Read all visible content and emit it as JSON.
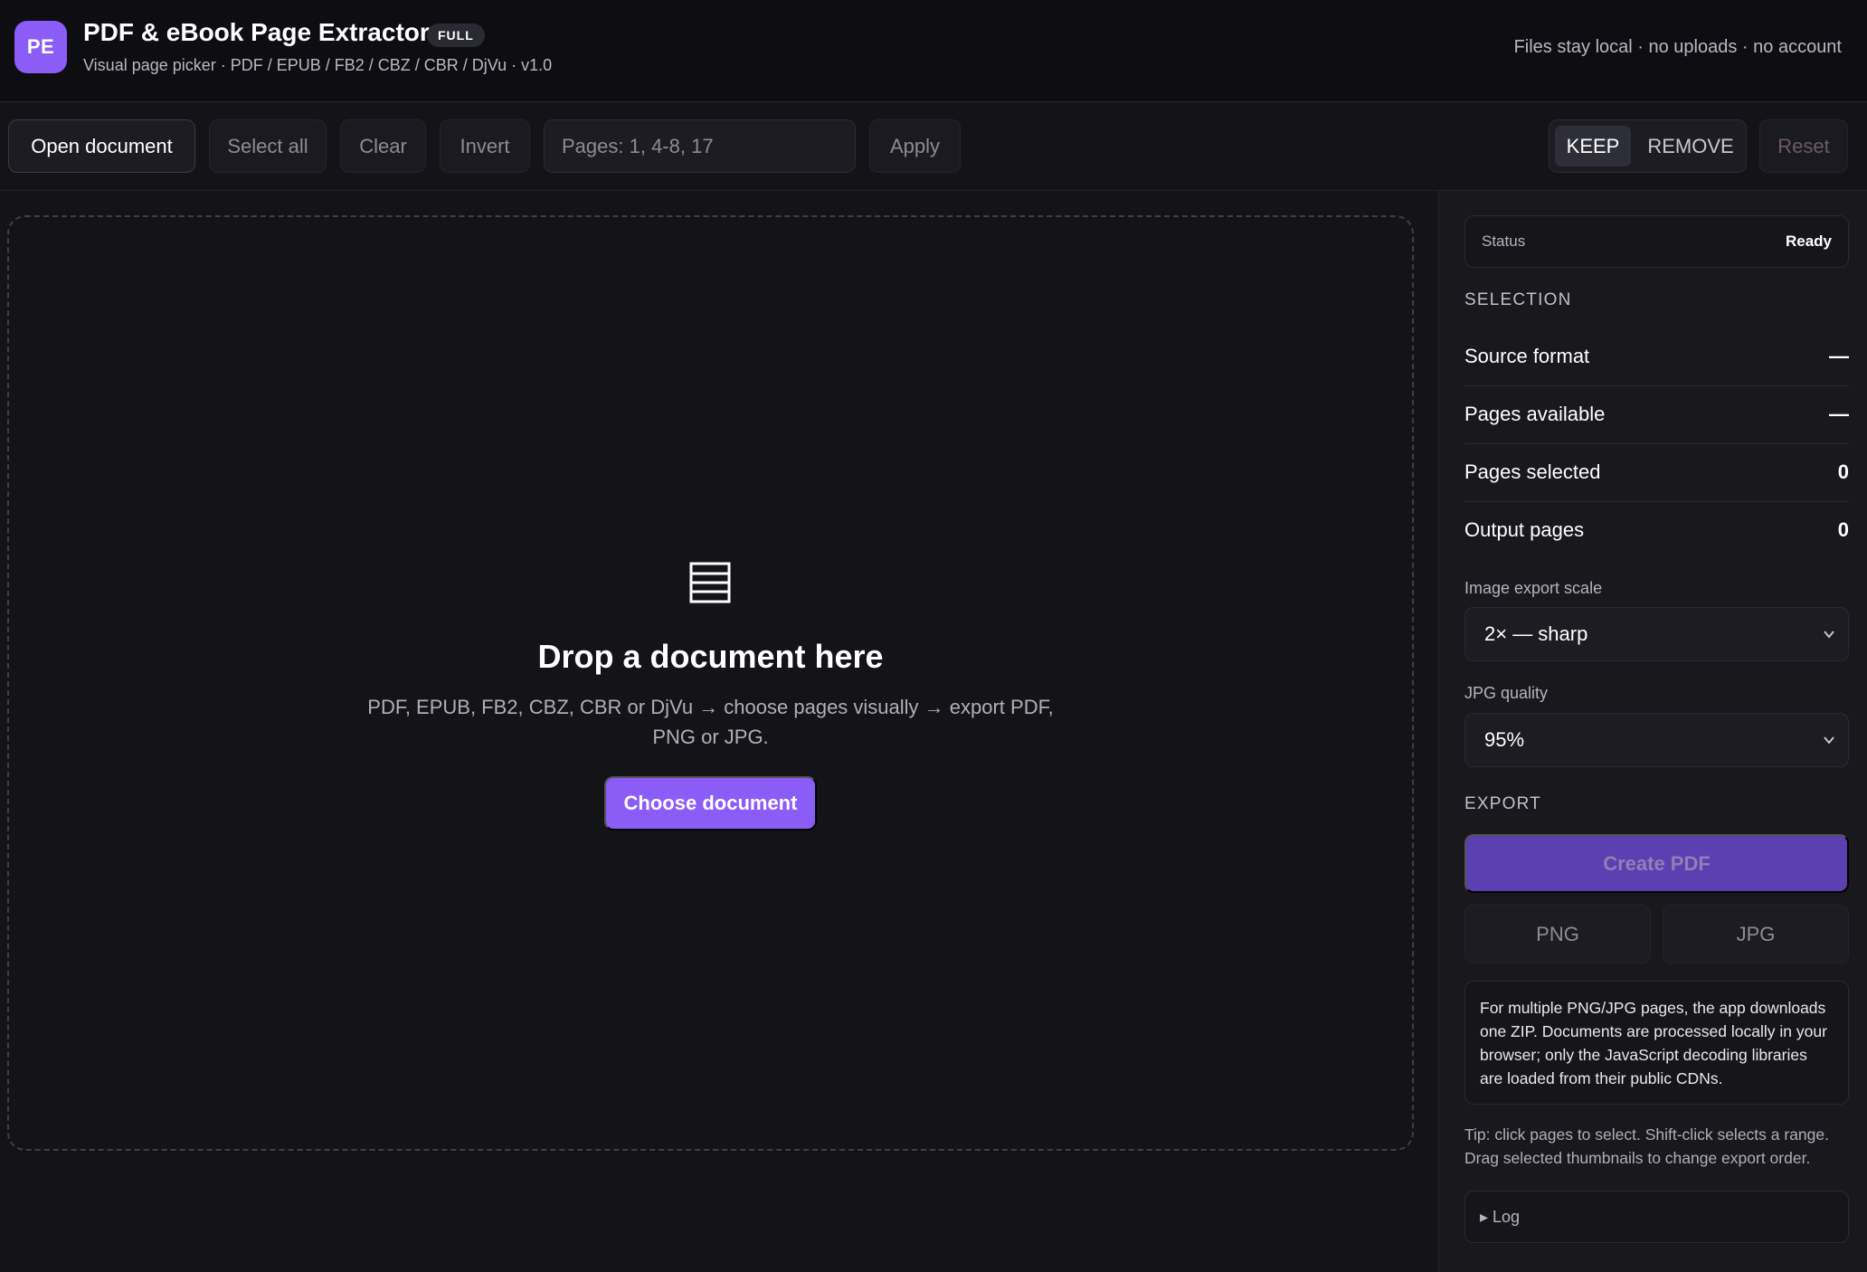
{
  "header": {
    "logo": "PE",
    "title": "PDF & eBook Page Extractor",
    "badge": "FULL",
    "subtitle": "Visual page picker · PDF / EPUB / FB2 / CBZ / CBR / DjVu · v1.0",
    "privacy": "Files stay local · no uploads · no account"
  },
  "toolbar": {
    "open": "Open document",
    "select_all": "Select all",
    "clear": "Clear",
    "invert": "Invert",
    "pages_placeholder": "Pages: 1, 4-8, 17",
    "apply": "Apply",
    "keep": "KEEP",
    "remove": "REMOVE",
    "reset": "Reset"
  },
  "dropzone": {
    "icon": "document-lines-icon",
    "title": "Drop a document here",
    "description": "PDF, EPUB, FB2, CBZ, CBR or DjVu → choose pages visually → export PDF, PNG or JPG.",
    "choose": "Choose document"
  },
  "panel": {
    "status_label": "Status",
    "status_value": "Ready",
    "selection_heading": "SELECTION",
    "stats": [
      {
        "label": "Source format",
        "value": "—"
      },
      {
        "label": "Pages available",
        "value": "—"
      },
      {
        "label": "Pages selected",
        "value": "0"
      },
      {
        "label": "Output pages",
        "value": "0"
      }
    ],
    "scale_label": "Image export scale",
    "scale_value": "2× — sharp",
    "quality_label": "JPG quality",
    "quality_value": "95%",
    "export_heading": "EXPORT",
    "create_pdf": "Create PDF",
    "png": "PNG",
    "jpg": "JPG",
    "info": "For multiple PNG/JPG pages, the app downloads one ZIP. Documents are processed locally in your browser; only the JavaScript decoding libraries are loaded from their public CDNs.",
    "tip": "Tip: click pages to select. Shift-click selects a range. Drag selected thumbnails to change export order.",
    "log": "▸ Log"
  },
  "colors": {
    "accent": "#8b5cf6",
    "background": "#141418",
    "header_bg": "#0e0e12"
  }
}
